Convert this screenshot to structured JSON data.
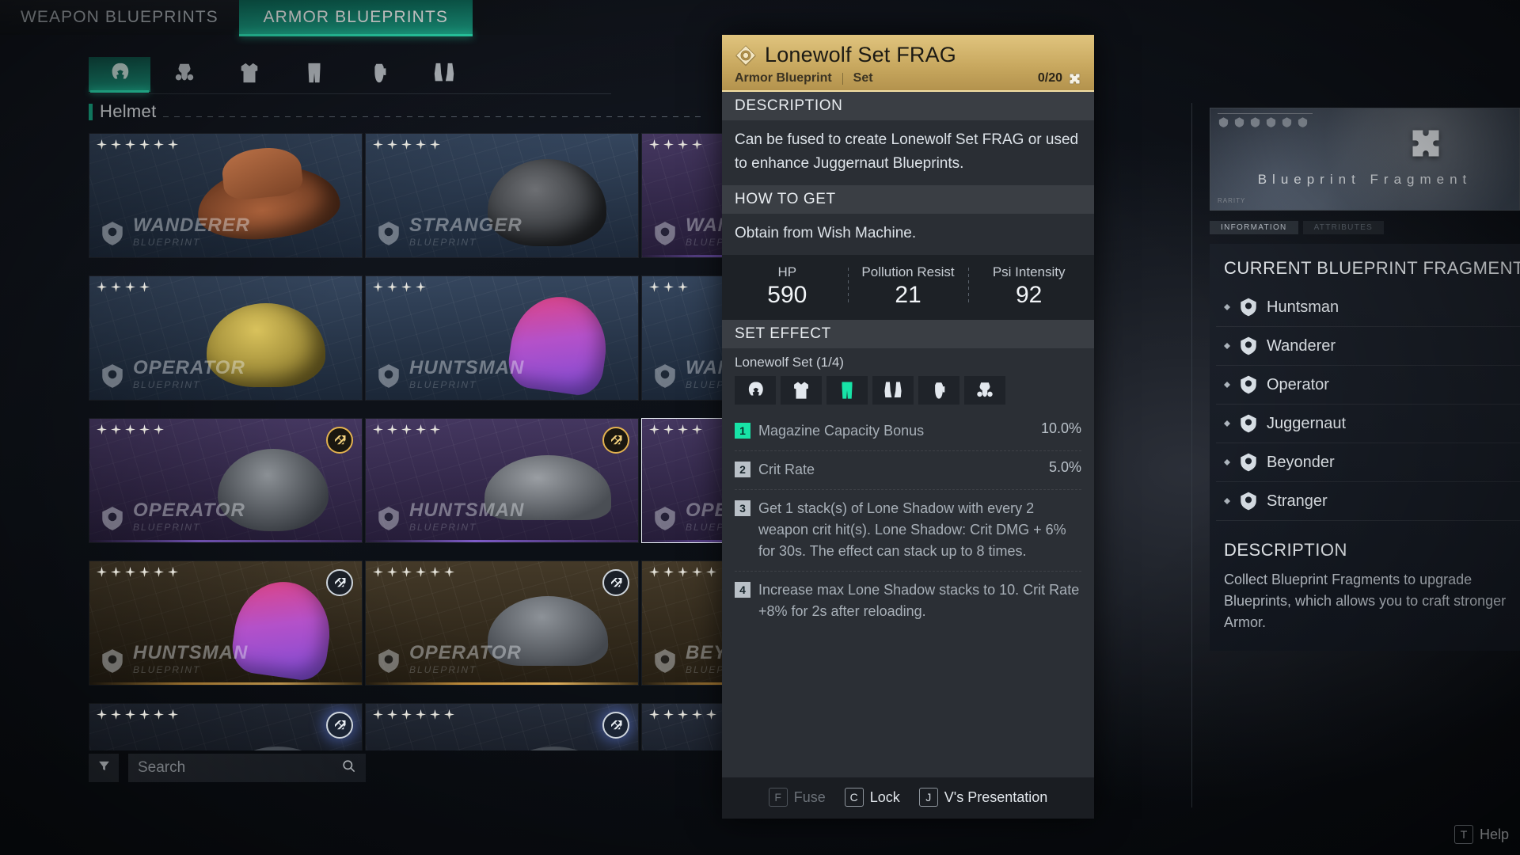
{
  "tabs": [
    {
      "label": "WEAPON BLUEPRINTS",
      "active": false
    },
    {
      "label": "ARMOR BLUEPRINTS",
      "active": true
    }
  ],
  "categories": [
    {
      "name": "helmet",
      "icon": "helmet-icon",
      "active": true
    },
    {
      "name": "mask",
      "icon": "gasmask-icon",
      "active": false
    },
    {
      "name": "chest",
      "icon": "vest-icon",
      "active": false
    },
    {
      "name": "legs",
      "icon": "pants-icon",
      "active": false
    },
    {
      "name": "gloves",
      "icon": "gloves-icon",
      "active": false
    },
    {
      "name": "boots",
      "icon": "boots-icon",
      "active": false
    }
  ],
  "section": {
    "label": "Helmet"
  },
  "grid": {
    "items": [
      {
        "faction": "WANDERER",
        "sub": "BLUEPRINT",
        "stars": 6,
        "rarity": "blue",
        "art": "art-hat",
        "badge": "",
        "selected": false
      },
      {
        "faction": "STRANGER",
        "sub": "BLUEPRINT",
        "stars": 5,
        "rarity": "blue",
        "art": "art-helm-dark",
        "badge": "",
        "selected": false
      },
      {
        "faction": "WANDERER",
        "sub": "BLUEPRINT",
        "stars": 4,
        "rarity": "purple",
        "art": "art-dark-sm",
        "badge": "",
        "selected": false
      },
      {
        "faction": "OPERATOR",
        "sub": "BLUEPRINT",
        "stars": 4,
        "rarity": "blue",
        "art": "art-helm-yel",
        "badge": "",
        "selected": false
      },
      {
        "faction": "HUNTSMAN",
        "sub": "BLUEPRINT",
        "stars": 4,
        "rarity": "blue",
        "art": "art-hood-pk",
        "badge": "",
        "selected": false
      },
      {
        "faction": "WANDERER",
        "sub": "BLUEPRINT",
        "stars": 3,
        "rarity": "blue",
        "art": "art-helm-red",
        "badge": "",
        "selected": false
      },
      {
        "faction": "OPERATOR",
        "sub": "BLUEPRINT",
        "stars": 5,
        "rarity": "purple",
        "art": "art-mask-gray",
        "badge": "gold",
        "selected": false
      },
      {
        "faction": "HUNTSMAN",
        "sub": "BLUEPRINT",
        "stars": 5,
        "rarity": "purple",
        "art": "art-cap-gray",
        "badge": "gold",
        "selected": false
      },
      {
        "faction": "OPERATOR",
        "sub": "BLUEPRINT",
        "stars": 4,
        "rarity": "purple",
        "art": "art-mask-gray",
        "badge": "gold",
        "selected": true
      },
      {
        "faction": "HUNTSMAN",
        "sub": "BLUEPRINT",
        "stars": 6,
        "rarity": "gold",
        "art": "art-hood-pk",
        "badge": "white",
        "selected": false
      },
      {
        "faction": "OPERATOR",
        "sub": "BLUEPRINT",
        "stars": 6,
        "rarity": "gold",
        "art": "art-bucket",
        "badge": "white",
        "selected": false
      },
      {
        "faction": "BEYONDER",
        "sub": "BLUEPRINT",
        "stars": 5,
        "rarity": "gold",
        "art": "art-dark-sm",
        "badge": "white",
        "selected": false
      },
      {
        "faction": "",
        "sub": "",
        "stars": 6,
        "rarity": "dark",
        "art": "art-dark-sm",
        "badge": "blueglow",
        "selected": false
      },
      {
        "faction": "",
        "sub": "",
        "stars": 6,
        "rarity": "dark",
        "art": "art-dark-sm",
        "badge": "blueglow",
        "selected": false
      },
      {
        "faction": "",
        "sub": "",
        "stars": 5,
        "rarity": "dark",
        "art": "art-dark-sm",
        "badge": "blueglow",
        "selected": false
      }
    ]
  },
  "search": {
    "placeholder": "Search",
    "value": ""
  },
  "filter": {
    "icon": "filter-icon"
  },
  "tooltip": {
    "title": "Lonewolf Set FRAG",
    "rarity_icon": "blueprint-rarity-icon",
    "kind": "Armor Blueprint",
    "type": "Set",
    "count": "0/20",
    "count_icon": "fragment-icon",
    "description_header": "DESCRIPTION",
    "description": "Can be fused to create Lonewolf Set FRAG or used to enhance Juggernaut Blueprints.",
    "howto_header": "HOW TO GET",
    "howto": "Obtain from Wish Machine.",
    "stats": [
      {
        "label": "HP",
        "value": "590"
      },
      {
        "label": "Pollution Resist",
        "value": "21"
      },
      {
        "label": "Psi Intensity",
        "value": "92"
      }
    ],
    "set_effect_header": "SET EFFECT",
    "set_name": "Lonewolf Set (1/4)",
    "set_slots": [
      {
        "name": "helmet",
        "icon": "helmet-icon",
        "active": false
      },
      {
        "name": "chest",
        "icon": "vest-icon",
        "active": false
      },
      {
        "name": "legs",
        "icon": "pants-icon",
        "active": true
      },
      {
        "name": "boots",
        "icon": "boots-icon",
        "active": false
      },
      {
        "name": "gloves",
        "icon": "gloves-icon",
        "active": false
      },
      {
        "name": "mask",
        "icon": "gasmask-icon",
        "active": false
      }
    ],
    "effects": [
      {
        "num": "1",
        "active": true,
        "text": "Magazine Capacity Bonus",
        "value": "10.0%"
      },
      {
        "num": "2",
        "active": false,
        "text": "Crit Rate",
        "value": "5.0%"
      },
      {
        "num": "3",
        "active": false,
        "text": "Get 1 stack(s) of Lone Shadow with every 2 weapon crit hit(s). Lone Shadow: Crit DMG + 6% for 30s. The effect can stack up to 8 times.",
        "value": ""
      },
      {
        "num": "4",
        "active": false,
        "text": "Increase max Lone Shadow stacks to 10. Crit Rate +8% for 2s after reloading.",
        "value": ""
      }
    ],
    "footer": [
      {
        "key": "F",
        "label": "Fuse",
        "disabled": true
      },
      {
        "key": "C",
        "label": "Lock",
        "disabled": false
      },
      {
        "key": "J",
        "label": "V's Presentation",
        "disabled": false
      }
    ]
  },
  "right_panel": {
    "banner_name": "Blueprint Fragment",
    "banner_corner": "RARITY",
    "banner_icon": "puzzle-piece-icon",
    "tabs": [
      {
        "label": "INFORMATION",
        "muted": false
      },
      {
        "label": "ATTRIBUTES",
        "muted": true
      }
    ],
    "title": "CURRENT BLUEPRINT FRAGMENT",
    "fragments": [
      {
        "name": "Huntsman",
        "icon": "huntsman-faction-icon"
      },
      {
        "name": "Wanderer",
        "icon": "wanderer-faction-icon"
      },
      {
        "name": "Operator",
        "icon": "operator-faction-icon"
      },
      {
        "name": "Juggernaut",
        "icon": "juggernaut-faction-icon"
      },
      {
        "name": "Beyonder",
        "icon": "beyonder-faction-icon"
      },
      {
        "name": "Stranger",
        "icon": "stranger-faction-icon"
      }
    ],
    "description_header": "DESCRIPTION",
    "description": "Collect Blueprint Fragments to upgrade Blueprints, which allows you to craft stronger Armor."
  },
  "help_hint": {
    "key": "T",
    "label": "Help"
  },
  "colors": {
    "accent_teal": "#17e3a7",
    "tab_active": "#17917a",
    "header_gold": "#c8a85f",
    "badge_gold": "#e3b24f"
  }
}
